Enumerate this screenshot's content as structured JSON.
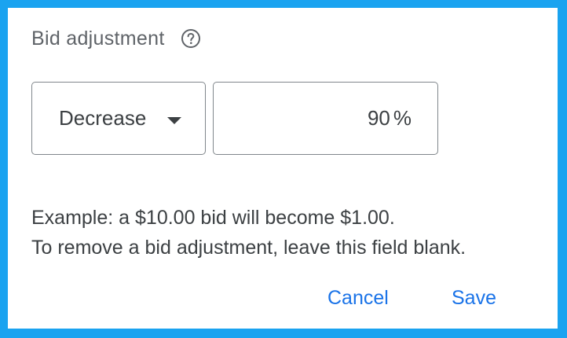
{
  "dialog": {
    "title": "Bid adjustment",
    "help_icon": "help-circle-icon",
    "direction": {
      "selected": "Decrease",
      "icon": "arrow-drop-down-icon"
    },
    "amount": {
      "value": "90",
      "suffix": "%"
    },
    "example_line": "Example: a $10.00 bid will become $1.00.",
    "help_line": "To remove a bid adjustment, leave this field blank.",
    "cancel_label": "Cancel",
    "save_label": "Save"
  },
  "colors": {
    "border_frame": "#1aa3f0",
    "accent": "#1a73e8",
    "text": "#3c4043",
    "muted": "#5f6368",
    "outline": "#80868b"
  }
}
